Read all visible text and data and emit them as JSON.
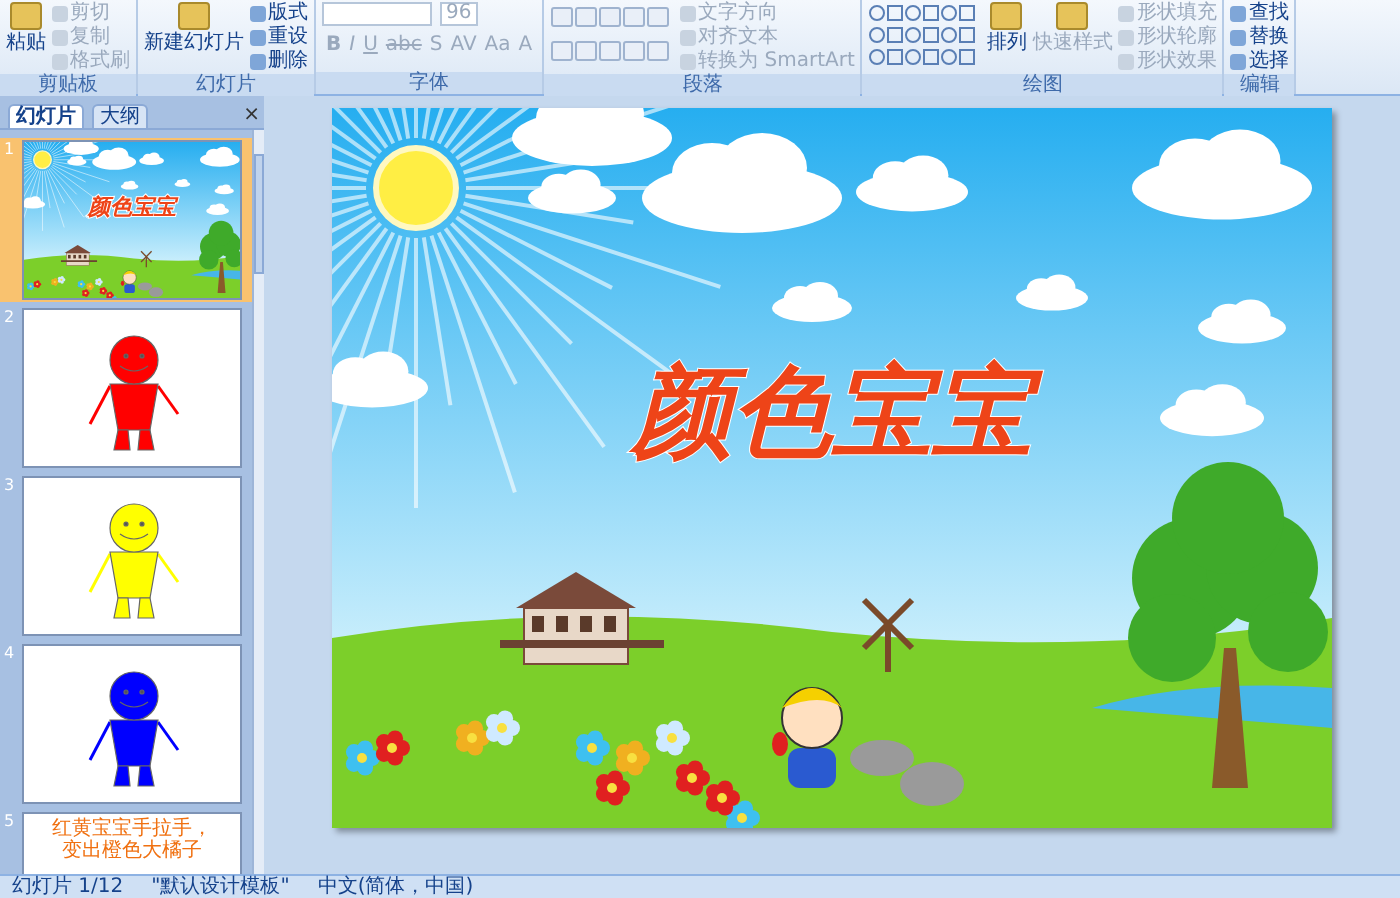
{
  "ribbon": {
    "groups": [
      {
        "label": "剪贴板",
        "items": [
          {
            "label": "粘贴",
            "kind": "large",
            "disabled": false
          },
          {
            "label": "剪切",
            "kind": "small",
            "disabled": true
          },
          {
            "label": "复制",
            "kind": "small",
            "disabled": true
          },
          {
            "label": "格式刷",
            "kind": "small",
            "disabled": true
          }
        ]
      },
      {
        "label": "幻灯片",
        "items": [
          {
            "label": "新建幻灯片",
            "kind": "large",
            "disabled": false
          },
          {
            "label": "版式",
            "kind": "small",
            "disabled": false
          },
          {
            "label": "重设",
            "kind": "small",
            "disabled": false
          },
          {
            "label": "删除",
            "kind": "small",
            "disabled": false
          }
        ]
      },
      {
        "label": "字体",
        "kind": "font",
        "font_size": "96",
        "buttons": [
          "B",
          "I",
          "U",
          "abc",
          "S",
          "AV",
          "Aa",
          "A"
        ],
        "disabled": true
      },
      {
        "label": "段落",
        "kind": "paragraph",
        "items": [
          {
            "label": "文字方向",
            "kind": "small",
            "disabled": true
          },
          {
            "label": "对齐文本",
            "kind": "small",
            "disabled": true
          },
          {
            "label": "转换为 SmartArt",
            "kind": "small",
            "disabled": true
          }
        ]
      },
      {
        "label": "绘图",
        "kind": "drawing",
        "items": [
          {
            "label": "排列",
            "kind": "large",
            "disabled": false
          },
          {
            "label": "快速样式",
            "kind": "large",
            "disabled": true
          },
          {
            "label": "形状填充",
            "kind": "small",
            "disabled": true
          },
          {
            "label": "形状轮廓",
            "kind": "small",
            "disabled": true
          },
          {
            "label": "形状效果",
            "kind": "small",
            "disabled": true
          }
        ]
      },
      {
        "label": "编辑",
        "items": [
          {
            "label": "查找",
            "kind": "small",
            "disabled": false
          },
          {
            "label": "替换",
            "kind": "small",
            "disabled": false
          },
          {
            "label": "选择",
            "kind": "small",
            "disabled": false
          }
        ]
      }
    ]
  },
  "panel": {
    "tabs": [
      {
        "label": "幻灯片",
        "selected": true
      },
      {
        "label": "大纲",
        "selected": false
      }
    ],
    "close": "×"
  },
  "slides": [
    {
      "number": "1",
      "kind": "scene",
      "title": "颜色宝宝",
      "selected": true
    },
    {
      "number": "2",
      "kind": "figure",
      "color": "#ff0000",
      "selected": false
    },
    {
      "number": "3",
      "kind": "figure",
      "color": "#ffff00",
      "selected": false
    },
    {
      "number": "4",
      "kind": "figure",
      "color": "#0000ff",
      "selected": false
    },
    {
      "number": "5",
      "kind": "text",
      "lines": [
        "红黄宝宝手拉手，",
        "变出橙色大橘子"
      ],
      "selected": false
    }
  ],
  "main_slide": {
    "title": "颜色宝宝"
  },
  "status_bar": [
    "幻灯片 1/12",
    "\"默认设计模板\"",
    "中文(简体，中国)"
  ]
}
